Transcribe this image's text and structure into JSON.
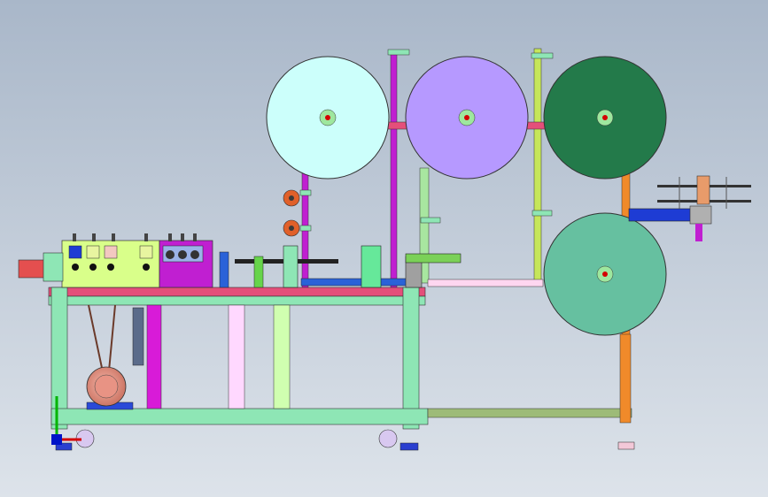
{
  "viewport": {
    "background_top": "#a9b7c9",
    "background_bottom": "#dde3ea"
  },
  "machine": {
    "rolls": [
      {
        "id": "roll-1",
        "color": "#ccfffb",
        "core": "#9ee79e"
      },
      {
        "id": "roll-2",
        "color": "#b699ff",
        "core": "#9ee79e"
      },
      {
        "id": "roll-3",
        "color": "#237a4a",
        "core": "#9ee79e"
      },
      {
        "id": "roll-4",
        "color": "#66c0a0",
        "core": "#9ee79e"
      }
    ],
    "colors": {
      "frame_green": "#8ee6b5",
      "frame_pink": "#e44f7a",
      "frame_dark": "#2b2b2b",
      "control_box": "#d9ff8a",
      "drive_box": "#c01fd1",
      "motor": "#e89384",
      "axis_x": "#d40000",
      "axis_y": "#00b400",
      "axis_z": "#0014c8"
    }
  }
}
